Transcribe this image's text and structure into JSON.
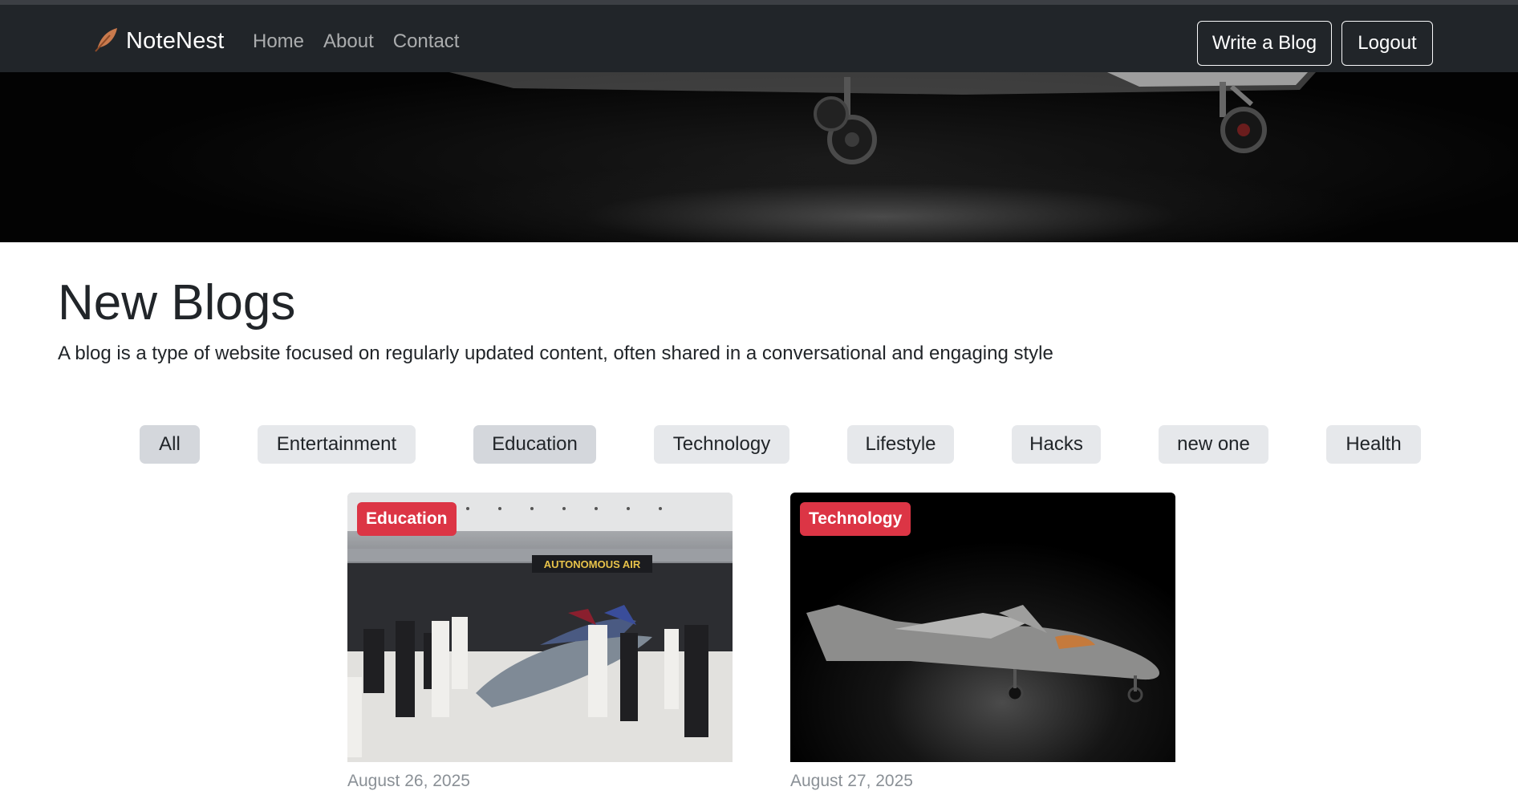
{
  "nav": {
    "brand": "NoteNest",
    "links": [
      "Home",
      "About",
      "Contact"
    ],
    "write_button": "Write a Blog",
    "logout_button": "Logout"
  },
  "main": {
    "heading": "New Blogs",
    "lead": "A blog is a type of website focused on regularly updated content, often shared in a conversational and engaging style"
  },
  "filters": {
    "items": [
      "All",
      "Entertainment",
      "Education",
      "Technology",
      "Lifestyle",
      "Hacks",
      "new one",
      "Health"
    ],
    "active": [
      "All",
      "Education"
    ]
  },
  "cards": [
    {
      "category": "Education",
      "date": "August 26, 2025",
      "image_sign_text": "AUTONOMOUS AIR"
    },
    {
      "category": "Technology",
      "date": "August 27, 2025"
    }
  ],
  "colors": {
    "navbar": "#212529",
    "badge": "#dc3545",
    "chip": "#e6e8eb",
    "chip_active": "#d4d7dc"
  },
  "icons": {
    "brand": "feather-icon"
  }
}
